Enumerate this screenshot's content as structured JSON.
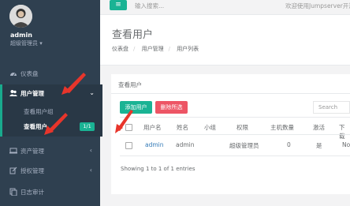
{
  "sidebar": {
    "username": "admin",
    "role": "超级管理员",
    "items": [
      {
        "label": "仪表盘",
        "icon": "dashboard-icon"
      },
      {
        "label": "用户管理",
        "icon": "users-icon"
      },
      {
        "label": "资产管理",
        "icon": "desktop-icon"
      },
      {
        "label": "授权管理",
        "icon": "edit-icon"
      },
      {
        "label": "日志审计",
        "icon": "copy-icon"
      }
    ],
    "subitems": [
      {
        "label": "查看用户组"
      },
      {
        "label": "查看用户"
      }
    ],
    "badge": "1/1"
  },
  "topbar": {
    "search_placeholder": "输入搜索...",
    "welcome": "欢迎使用Jumpserver开源"
  },
  "page": {
    "title": "查看用户",
    "breadcrumb": [
      "仪表盘",
      "用户管理",
      "用户列表"
    ]
  },
  "panel": {
    "title": "查看用户",
    "add_button": "添加用户",
    "delete_button": "删除所选",
    "search_placeholder": "Search",
    "columns": [
      "用户名",
      "姓名",
      "小组",
      "权限",
      "主机数量",
      "激活",
      "下载"
    ],
    "rows": [
      {
        "username": "admin",
        "name": "admin",
        "group": "",
        "role": "超级管理员",
        "hosts": "0",
        "active": "是",
        "download": "No"
      }
    ],
    "info": "Showing 1 to 1 of 1 entries"
  },
  "colors": {
    "sidebar_bg": "#2f4050",
    "primary": "#1ab394",
    "danger": "#ed5565",
    "annotation": "#e8352b"
  }
}
